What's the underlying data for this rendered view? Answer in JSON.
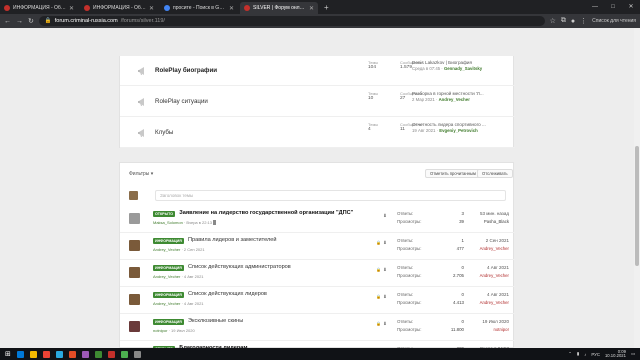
{
  "browser": {
    "tabs": [
      {
        "title": "ИНФОРМАЦИЯ - Общий устав | S",
        "fav": "#c4302b",
        "active": false
      },
      {
        "title": "ИНФОРМАЦИЯ - Общий устав | S",
        "fav": "#c4302b",
        "active": false
      },
      {
        "title": "просите - Поиск в Google",
        "fav": "#4285f4",
        "active": false
      },
      {
        "title": "SILVER | Форум онлайн-игры C...",
        "fav": "#c4302b",
        "active": true
      }
    ],
    "new_tab": "+",
    "win_controls": [
      "—",
      "□",
      "✕"
    ],
    "url_host": "forum.criminal-russia.com",
    "url_path": "/forums/silver.119/",
    "reading_list": "Список для чтения"
  },
  "forums": [
    {
      "title": "RolePlay биографии",
      "bold": true,
      "threads_label": "Темы",
      "threads": "104",
      "posts_label": "Сообщения",
      "posts": "1.579",
      "last_title": "Denis Lakazkov | Биография",
      "last_date": "Среда в 07:45",
      "last_user": "Gennady_Savitsky"
    },
    {
      "title": "RolePlay ситуации",
      "bold": false,
      "threads_label": "Темы",
      "threads": "10",
      "posts_label": "Сообщения",
      "posts": "27",
      "last_title": "Разборка в горной местности 'Л...",
      "last_date": "2 Мар 2021",
      "last_user": "Andrey_Vecher"
    },
    {
      "title": "Клубы",
      "bold": false,
      "threads_label": "Темы",
      "threads": "4",
      "posts_label": "Сообщения",
      "posts": "11",
      "last_title": "Отчетность лидера спортивного ...",
      "last_date": "19 Авг 2021",
      "last_user": "Evgeniy_Petrovich"
    }
  ],
  "toolbar": {
    "filters": "Фильтры ▾",
    "mark_read": "Отметить прочитанным",
    "watch": "Отслеживать",
    "quick_placeholder": "Заголовок темы"
  },
  "threads": [
    {
      "badge": "ОТКРЫТО",
      "title": "Заявление на лидерство государственной организации \"ДПС\"",
      "bold": true,
      "author": "Maksa_Solomon",
      "date": "Вчера в 22:13",
      "pinned": true,
      "locked": false,
      "replies": "3",
      "views": "39",
      "last_time": "53 мин. назад",
      "last_user": "Pasha_Black",
      "last_dark": true,
      "avatar": "#9a9a9a",
      "cursor": true
    },
    {
      "badge": "ИНФОРМАЦИЯ",
      "title": "Правила лидеров и заместителей",
      "bold": false,
      "author": "Andrey_Vecher",
      "date": "2 Сен 2021",
      "pinned": true,
      "locked": true,
      "replies": "1",
      "views": "477",
      "last_time": "2 Сен 2021",
      "last_user": "Andrey_Vecher",
      "last_dark": false,
      "avatar": "#7a5a3a",
      "cursor": false
    },
    {
      "badge": "ИНФОРМАЦИЯ",
      "title": "Список действующих администраторов",
      "bold": false,
      "author": "Andrey_Vecher",
      "date": "4 Авг 2021",
      "pinned": true,
      "locked": true,
      "replies": "0",
      "views": "2.705",
      "last_time": "4 Авг 2021",
      "last_user": "Andrey_Vecher",
      "last_dark": false,
      "avatar": "#7a5a3a",
      "cursor": false
    },
    {
      "badge": "ИНФОРМАЦИЯ",
      "title": "Список действующих лидеров",
      "bold": false,
      "author": "Andrey_Vecher",
      "date": "4 Авг 2021",
      "pinned": true,
      "locked": true,
      "replies": "0",
      "views": "4.413",
      "last_time": "4 Авг 2021",
      "last_user": "Andrey_Vecher",
      "last_dark": false,
      "avatar": "#7a5a3a",
      "cursor": false
    },
    {
      "badge": "ИНФОРМАЦИЯ",
      "title": "Эксклюзивные скины",
      "bold": false,
      "author": "notnipor",
      "date": "19 Июл 2020",
      "pinned": true,
      "locked": true,
      "replies": "0",
      "views": "11.800",
      "last_time": "19 Июл 2020",
      "last_user": "notnipor",
      "last_dark": false,
      "avatar": "#6a3a3a",
      "cursor": false
    },
    {
      "badge": "ОТКРЫТО",
      "title": "Благодарности лидерам",
      "bold": true,
      "author": "notnipor",
      "date": "1 Май 2020",
      "pinned": true,
      "locked": false,
      "replies": "299",
      "views": "11.649",
      "last_time": "Вчера в 04:53",
      "last_user": "Aleksandr_Orlovsky",
      "last_dark": true,
      "avatar": "#6a3a3a",
      "cursor": false
    }
  ],
  "labels": {
    "replies": "Ответы:",
    "views": "Просмотры:"
  },
  "taskbar": {
    "lang": "РУС",
    "time": "0:09",
    "date": "10.10.2021",
    "apps": [
      "#0078d7",
      "#f3b900",
      "#ea4335",
      "#2aa9e0",
      "#e34c26",
      "#9b59b6",
      "#3e8a32",
      "#c4302b",
      "#4caf50",
      "#888888"
    ]
  }
}
